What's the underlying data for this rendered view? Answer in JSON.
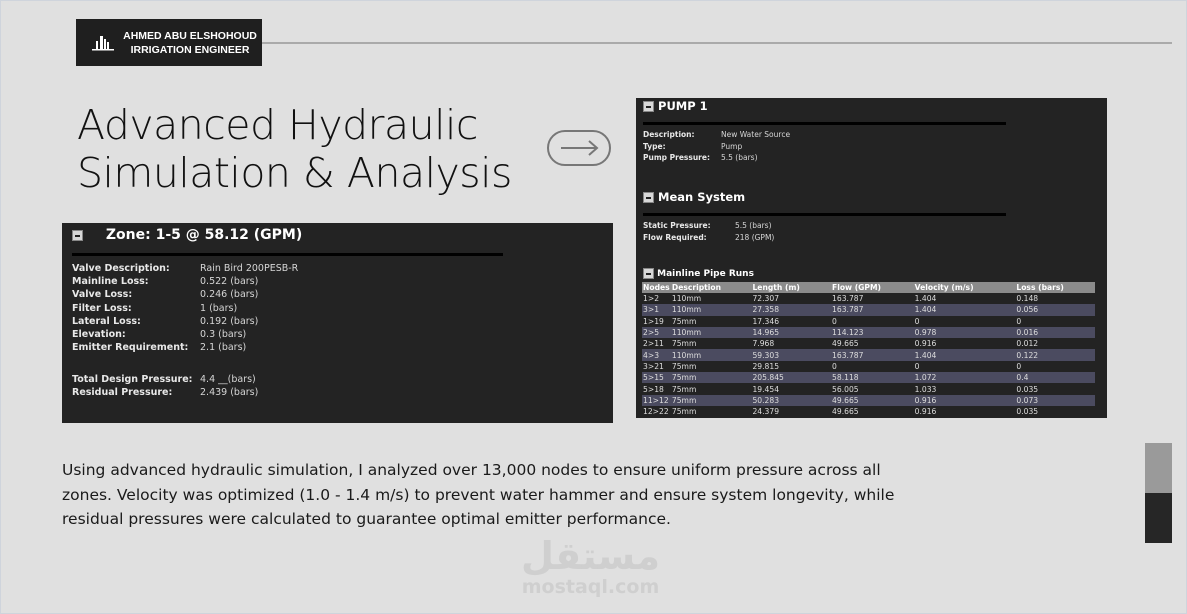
{
  "header": {
    "name": "AHMED ABU ELSHOHOUD",
    "role": "IRRIGATION ENGINEER"
  },
  "title": {
    "line1": "Advanced Hydraulic",
    "line2": "Simulation & Analysis"
  },
  "zone": {
    "heading": "Zone: 1-5 @ 58.12 (GPM)",
    "rows": [
      [
        "Valve Description:",
        "Rain Bird 200PESB-R"
      ],
      [
        "Mainline Loss:",
        "0.522 (bars)"
      ],
      [
        "Valve Loss:",
        "0.246 (bars)"
      ],
      [
        "Filter Loss:",
        "1 (bars)"
      ],
      [
        "Lateral Loss:",
        "0.192 (bars)"
      ],
      [
        "Elevation:",
        "0.3 (bars)"
      ],
      [
        "Emitter Requirement:",
        "2.1 (bars)"
      ]
    ],
    "totals": [
      [
        "Total Design Pressure:",
        "4.4 __(bars)"
      ],
      [
        "Residual Pressure:",
        "2.439 (bars)"
      ]
    ]
  },
  "pump": {
    "heading": "PUMP 1",
    "rows": [
      [
        "Description:",
        "New Water Source"
      ],
      [
        "Type:",
        "Pump"
      ],
      [
        "Pump Pressure:",
        "5.5 (bars)"
      ]
    ]
  },
  "mean": {
    "heading": "Mean System",
    "rows": [
      [
        "Static Pressure:",
        "5.5 (bars)"
      ],
      [
        "Flow Required:",
        "218 (GPM)"
      ]
    ]
  },
  "mainline": {
    "heading": "Mainline Pipe Runs",
    "columns": [
      "Nodes",
      "Description",
      "Length (m)",
      "Flow (GPM)",
      "Velocity (m/s)",
      "Loss (bars)"
    ],
    "rows": [
      [
        "1>2",
        "110mm",
        "72.307",
        "163.787",
        "1.404",
        "0.148"
      ],
      [
        "3>1",
        "110mm",
        "27.358",
        "163.787",
        "1.404",
        "0.056"
      ],
      [
        "1>19",
        "75mm",
        "17.346",
        "0",
        "0",
        "0"
      ],
      [
        "2>5",
        "110mm",
        "14.965",
        "114.123",
        "0.978",
        "0.016"
      ],
      [
        "2>11",
        "75mm",
        "7.968",
        "49.665",
        "0.916",
        "0.012"
      ],
      [
        "4>3",
        "110mm",
        "59.303",
        "163.787",
        "1.404",
        "0.122"
      ],
      [
        "3>21",
        "75mm",
        "29.815",
        "0",
        "0",
        "0"
      ],
      [
        "5>15",
        "75mm",
        "205.845",
        "58.118",
        "1.072",
        "0.4"
      ],
      [
        "5>18",
        "75mm",
        "19.454",
        "56.005",
        "1.033",
        "0.035"
      ],
      [
        "11>12",
        "75mm",
        "50.283",
        "49.665",
        "0.916",
        "0.073"
      ],
      [
        "12>22",
        "75mm",
        "24.379",
        "49.665",
        "0.916",
        "0.035"
      ]
    ]
  },
  "description": "Using advanced hydraulic simulation, I analyzed over 13,000 nodes to ensure uniform pressure across all zones. Velocity was optimized (1.0 - 1.4 m/s) to prevent water hammer and ensure system longevity, while residual pressures were calculated to guarantee optimal emitter performance.",
  "watermark": {
    "arabic": "مستقل",
    "latin": "mostaql.com"
  }
}
